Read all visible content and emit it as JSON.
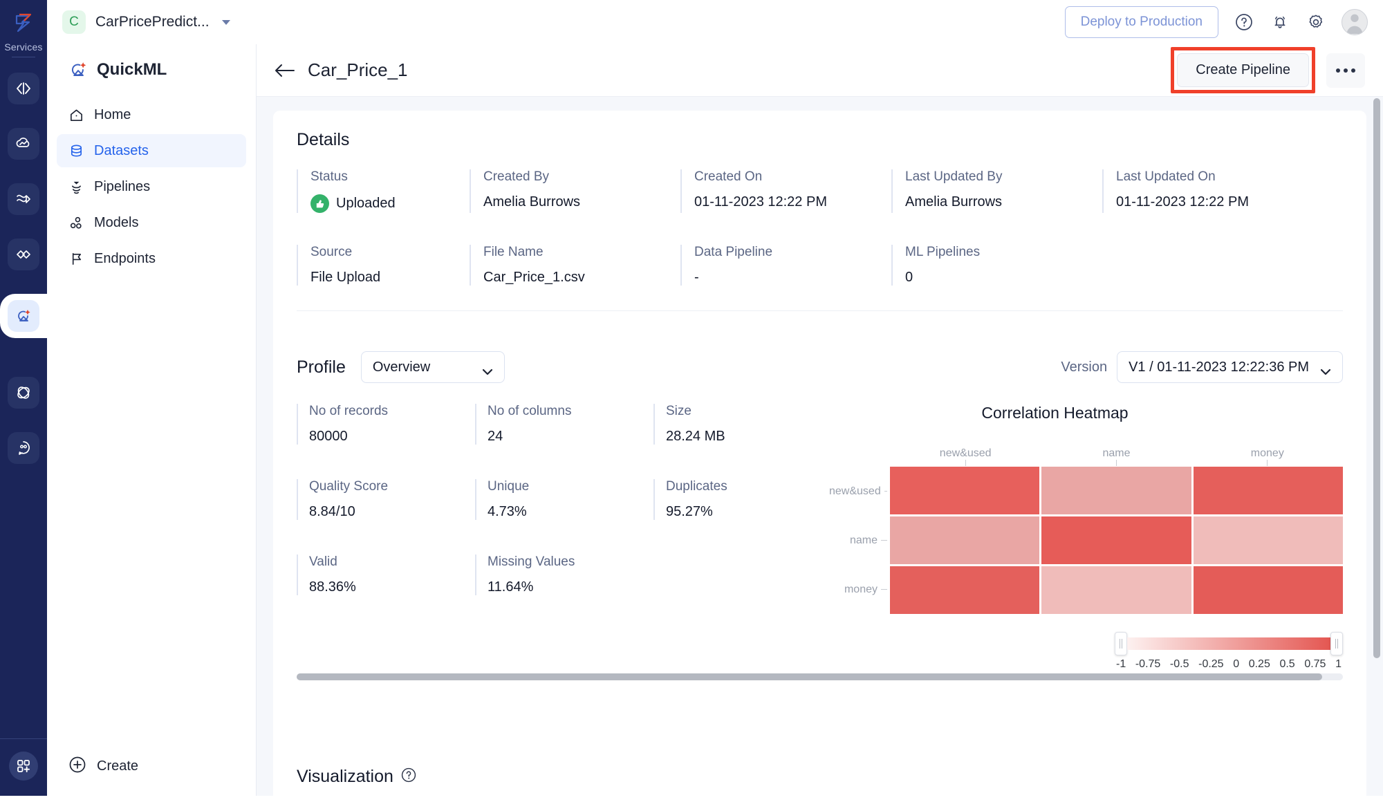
{
  "rail": {
    "logo_icon": "app-logo-icon",
    "services_label": "Services",
    "items": [
      {
        "icon": "code-brackets-icon",
        "active": false
      },
      {
        "icon": "cloud-analytics-icon",
        "active": false
      },
      {
        "icon": "data-flow-icon",
        "active": false
      },
      {
        "icon": "link-nodes-icon",
        "active": false
      },
      {
        "icon": "quickml-satellite-icon",
        "active": true
      },
      {
        "icon": "orbit-icon",
        "active": false
      },
      {
        "icon": "chat-bubble-icon",
        "active": false
      }
    ],
    "bottom_icon": "grid-plus-icon"
  },
  "topbar": {
    "project_initial": "C",
    "project_name": "CarPricePredict...",
    "deploy_label": "Deploy to Production",
    "help_icon": "question-circle-icon",
    "bell_icon": "notification-bell-icon",
    "gear_icon": "gear-icon",
    "avatar_icon": "user-avatar"
  },
  "sidebar": {
    "brand": "QuickML",
    "brand_icon": "quickml-satellite-icon",
    "items": [
      {
        "label": "Home",
        "icon": "home-icon",
        "active": false
      },
      {
        "label": "Datasets",
        "icon": "database-icon",
        "active": true
      },
      {
        "label": "Pipelines",
        "icon": "pipelines-icon",
        "active": false
      },
      {
        "label": "Models",
        "icon": "models-nodes-icon",
        "active": false
      },
      {
        "label": "Endpoints",
        "icon": "flag-icon",
        "active": false
      }
    ],
    "create_label": "Create",
    "create_icon": "plus-circle-icon"
  },
  "page": {
    "back_icon": "back-arrow-icon",
    "title": "Car_Price_1",
    "create_pipeline_label": "Create Pipeline",
    "overflow_icon": "more-options-icon",
    "highlight_color": "#f0402a"
  },
  "details": {
    "title": "Details",
    "row1": [
      {
        "label": "Status",
        "value": "Uploaded",
        "icon": "thumbs-up-icon",
        "icon_color": "#34b26a"
      },
      {
        "label": "Created By",
        "value": "Amelia Burrows"
      },
      {
        "label": "Created On",
        "value": "01-11-2023 12:22 PM"
      },
      {
        "label": "Last Updated By",
        "value": "Amelia Burrows"
      },
      {
        "label": "Last Updated On",
        "value": "01-11-2023 12:22 PM"
      }
    ],
    "row2": [
      {
        "label": "Source",
        "value": "File Upload"
      },
      {
        "label": "File Name",
        "value": "Car_Price_1.csv"
      },
      {
        "label": "Data Pipeline",
        "value": "-"
      },
      {
        "label": "ML Pipelines",
        "value": "0"
      }
    ]
  },
  "profile": {
    "title": "Profile",
    "selected_view": "Overview",
    "view_options": [
      "Overview"
    ],
    "version_label": "Version",
    "selected_version": "V1 / 01-11-2023 12:22:36 PM",
    "stats": [
      [
        {
          "label": "No of records",
          "value": "80000"
        },
        {
          "label": "No of columns",
          "value": "24"
        },
        {
          "label": "Size",
          "value": "28.24 MB"
        }
      ],
      [
        {
          "label": "Quality Score",
          "value": "8.84/10"
        },
        {
          "label": "Unique",
          "value": "4.73%"
        },
        {
          "label": "Duplicates",
          "value": "95.27%"
        }
      ],
      [
        {
          "label": "Valid",
          "value": "88.36%"
        },
        {
          "label": "Missing Values",
          "value": "11.64%"
        }
      ]
    ]
  },
  "chart_data": {
    "type": "heatmap",
    "title": "Correlation Heatmap",
    "x_categories": [
      "new&used",
      "name",
      "money"
    ],
    "y_categories": [
      "new&used",
      "name",
      "money"
    ],
    "values": [
      [
        0.82,
        0.38,
        0.74
      ],
      [
        0.38,
        0.84,
        0.28
      ],
      [
        0.76,
        0.26,
        0.85
      ]
    ],
    "cell_colors": [
      [
        "#e7605c",
        "#e9a6a4",
        "#e55f5b"
      ],
      [
        "#e9a6a4",
        "#e65c58",
        "#f0bcba"
      ],
      [
        "#e4605c",
        "#f0bcba",
        "#e45c58"
      ]
    ],
    "colorscale": {
      "low": "#fdf1f0",
      "high": "#e45752",
      "ticks": [
        "-1",
        "-0.75",
        "-0.5",
        "-0.25",
        "0",
        "0.25",
        "0.5",
        "0.75",
        "1"
      ],
      "range": [
        -1,
        1
      ]
    },
    "grid": false,
    "legend_position": "bottom-right"
  },
  "visualization": {
    "title": "Visualization",
    "help_icon": "question-circle-icon"
  }
}
